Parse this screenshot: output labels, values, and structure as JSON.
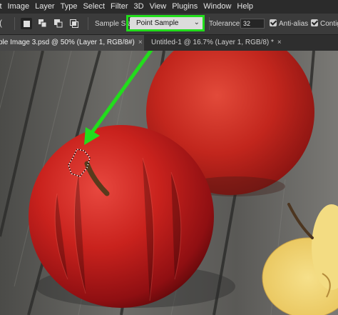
{
  "menubar": {
    "items": [
      "it",
      "Image",
      "Layer",
      "Type",
      "Select",
      "Filter",
      "3D",
      "View",
      "Plugins",
      "Window",
      "Help"
    ]
  },
  "options": {
    "tool_preset_fragment": "(",
    "sample_size_label": "Sample Size",
    "sample_size_value": "Point Sample",
    "tolerance_label": "Tolerance:",
    "tolerance_value": "32",
    "antialias_label": "Anti-alias",
    "contiguous_label": "Contig"
  },
  "tabs": [
    {
      "label": "ple Image 3.psd @ 50% (Layer 1, RGB/8#)",
      "close": "×",
      "active": true
    },
    {
      "label": "Untitled-1 @ 16.7% (Layer 1, RGB/8) *",
      "close": "×",
      "active": false
    }
  ],
  "colors": {
    "highlight": "#22dd1c",
    "menubar_bg": "#2b2b2b",
    "optionsbar_bg": "#3b3b3b"
  }
}
